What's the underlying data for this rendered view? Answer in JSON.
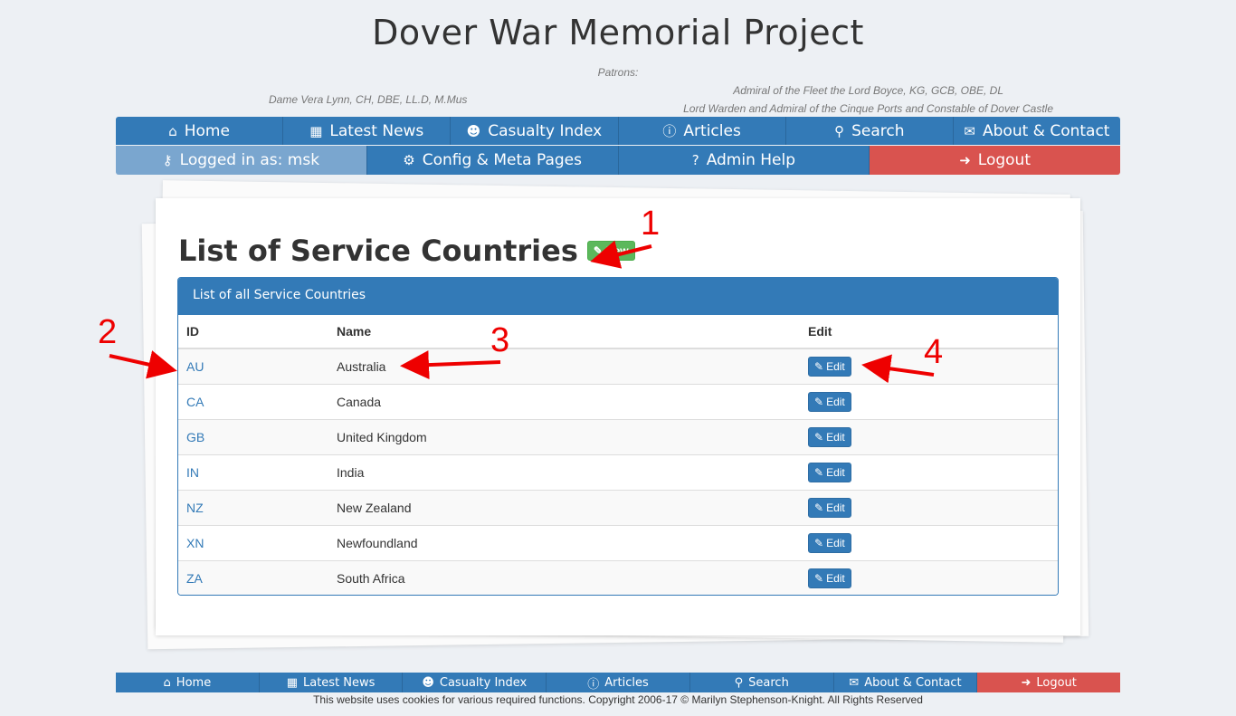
{
  "header": {
    "title": "Dover War Memorial Project",
    "patrons_label": "Patrons:",
    "patron_left": "Dame Vera Lynn, CH, DBE, LL.D, M.Mus",
    "patron_right_line1": "Admiral of the Fleet the Lord Boyce, KG, GCB, OBE, DL",
    "patron_right_line2": "Lord Warden and Admiral of the Cinque Ports and Constable of Dover Castle"
  },
  "nav_main": [
    {
      "label": "Home",
      "icon": "home-icon"
    },
    {
      "label": "Latest News",
      "icon": "calendar-icon"
    },
    {
      "label": "Casualty Index",
      "icon": "users-icon"
    },
    {
      "label": "Articles",
      "icon": "info-icon"
    },
    {
      "label": "Search",
      "icon": "search-icon"
    },
    {
      "label": "About & Contact",
      "icon": "envelope-icon"
    }
  ],
  "nav_admin": [
    {
      "label": "Logged in as: msk",
      "icon": "key-icon"
    },
    {
      "label": "Config & Meta Pages",
      "icon": "cogs-icon"
    },
    {
      "label": "Admin Help",
      "icon": "question-icon"
    },
    {
      "label": "Logout",
      "icon": "sign-out-icon"
    }
  ],
  "main": {
    "heading": "List of Service Countries",
    "new_button": "New",
    "panel_title": "List of all Service Countries",
    "columns": [
      "ID",
      "Name",
      "Edit"
    ],
    "rows": [
      {
        "id": "AU",
        "name": "Australia"
      },
      {
        "id": "CA",
        "name": "Canada"
      },
      {
        "id": "GB",
        "name": "United Kingdom"
      },
      {
        "id": "IN",
        "name": "India"
      },
      {
        "id": "NZ",
        "name": "New Zealand"
      },
      {
        "id": "XN",
        "name": "Newfoundland"
      },
      {
        "id": "ZA",
        "name": "South Africa"
      }
    ],
    "edit_label": "Edit"
  },
  "annotations": [
    "1",
    "2",
    "3",
    "4"
  ],
  "annotation_color": "#ee0000",
  "footer_nav": [
    {
      "label": "Home",
      "icon": "home-icon"
    },
    {
      "label": "Latest News",
      "icon": "calendar-icon"
    },
    {
      "label": "Casualty Index",
      "icon": "users-icon"
    },
    {
      "label": "Articles",
      "icon": "info-icon"
    },
    {
      "label": "Search",
      "icon": "search-icon"
    },
    {
      "label": "About & Contact",
      "icon": "envelope-icon"
    },
    {
      "label": "Logout",
      "icon": "sign-out-icon"
    }
  ],
  "footer": {
    "copyright": "This website uses cookies for various required functions. Copyright 2006-17 © Marilyn Stephenson-Knight. All Rights Reserved"
  },
  "colors": {
    "primary": "#337ab7",
    "danger": "#d9534f",
    "success": "#5cb85c",
    "logged_in": "#7aa6cf"
  }
}
